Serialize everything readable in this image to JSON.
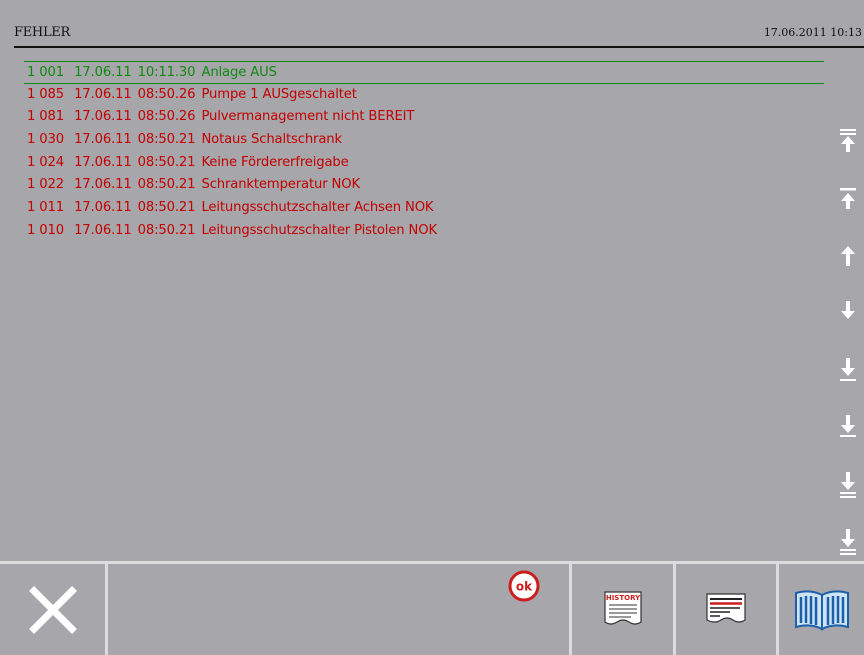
{
  "header": {
    "title": "FEHLER",
    "datetime": "17.06.2011 10:13"
  },
  "colors": {
    "background": "#a6a6ab",
    "error_text": "#c40000",
    "active_text": "#108a10",
    "divider": "#dcdcdc"
  },
  "errors": [
    {
      "id": "1 001",
      "date": "17.06.11",
      "time": "10:11.30",
      "message": "Anlage AUS",
      "status": "active"
    },
    {
      "id": "1 085",
      "date": "17.06.11",
      "time": "08:50.26",
      "message": "Pumpe 1 AUSgeschaltet",
      "status": "error"
    },
    {
      "id": "1 081",
      "date": "17.06.11",
      "time": "08:50.26",
      "message": "Pulvermanagement nicht BEREIT",
      "status": "error"
    },
    {
      "id": "1 030",
      "date": "17.06.11",
      "time": "08:50.21",
      "message": "Notaus Schaltschrank",
      "status": "error"
    },
    {
      "id": "1 024",
      "date": "17.06.11",
      "time": "08:50.21",
      "message": "Keine Fördererfreigabe",
      "status": "error"
    },
    {
      "id": "1 022",
      "date": "17.06.11",
      "time": "08:50.21",
      "message": "Schranktemperatur NOK",
      "status": "error"
    },
    {
      "id": "1 011",
      "date": "17.06.11",
      "time": "08:50.21",
      "message": "Leitungsschutzschalter Achsen NOK",
      "status": "error"
    },
    {
      "id": "1 010",
      "date": "17.06.11",
      "time": "08:50.21",
      "message": "Leitungsschutzschalter Pistolen NOK",
      "status": "error"
    }
  ],
  "scroll_buttons": [
    {
      "name": "scroll-top-icon"
    },
    {
      "name": "page-up-icon"
    },
    {
      "name": "line-up-icon"
    },
    {
      "name": "line-down-icon"
    },
    {
      "name": "page-down-icon"
    },
    {
      "name": "scroll-down-bar-icon"
    },
    {
      "name": "scroll-down-double-bar-icon"
    },
    {
      "name": "scroll-bottom-icon"
    }
  ],
  "toolbar": {
    "close": {
      "icon": "close-icon"
    },
    "acknowledge": {
      "label": "ok",
      "icon": "ok-acknowledge-icon"
    },
    "history": {
      "label": "HISTORY",
      "icon": "history-icon"
    },
    "report": {
      "icon": "report-icon"
    },
    "manual": {
      "icon": "manual-book-icon"
    }
  }
}
